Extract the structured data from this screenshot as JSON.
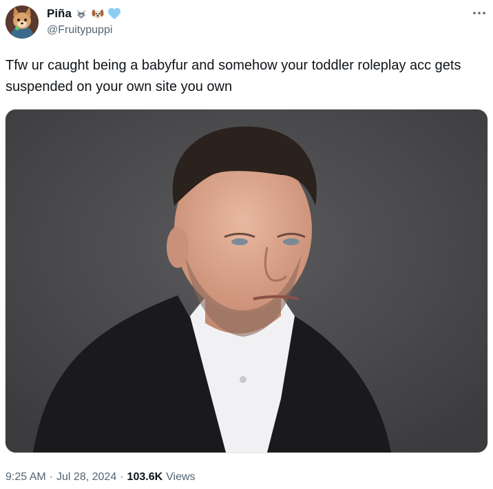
{
  "author": {
    "display_name": "Piña",
    "handle": "@Fruitypuppi",
    "badges": [
      "wolf-emoji",
      "dog-face-emoji",
      "light-blue-heart-emoji"
    ]
  },
  "tweet": {
    "text": "Tfw ur caught being a babyfur and somehow your toddler roleplay acc gets suspended on your own site you own"
  },
  "meta": {
    "time": "9:25 AM",
    "separator": "·",
    "date": "Jul 28, 2024",
    "views_count": "103.6K",
    "views_label": "Views"
  },
  "colors": {
    "text_primary": "#0f1419",
    "text_secondary": "#536471",
    "heart": "#8ecdf2",
    "photo_background": "#4b4b4d"
  }
}
